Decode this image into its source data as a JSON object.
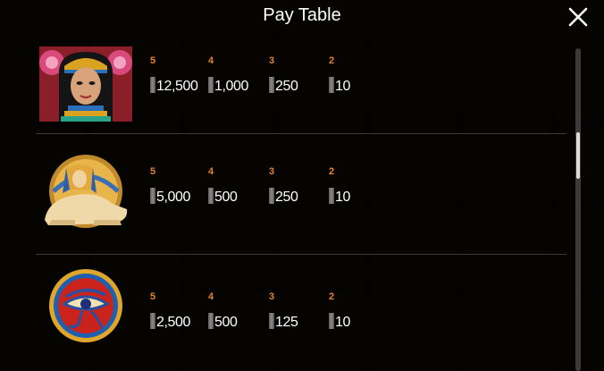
{
  "header": {
    "title": "Pay Table",
    "close_icon": "close-icon"
  },
  "paytable": [
    {
      "symbol": "cleopatra-icon",
      "payouts": [
        {
          "count": "5",
          "value": "12,500"
        },
        {
          "count": "4",
          "value": "1,000"
        },
        {
          "count": "3",
          "value": "250"
        },
        {
          "count": "2",
          "value": "10"
        }
      ]
    },
    {
      "symbol": "sphinx-icon",
      "payouts": [
        {
          "count": "5",
          "value": "5,000"
        },
        {
          "count": "4",
          "value": "500"
        },
        {
          "count": "3",
          "value": "250"
        },
        {
          "count": "2",
          "value": "10"
        }
      ]
    },
    {
      "symbol": "eye-of-horus-icon",
      "payouts": [
        {
          "count": "5",
          "value": "2,500"
        },
        {
          "count": "4",
          "value": "500"
        },
        {
          "count": "3",
          "value": "125"
        },
        {
          "count": "2",
          "value": "10"
        }
      ]
    }
  ],
  "colors": {
    "count_color": "#e8832a",
    "value_color": "#ffffff",
    "overlay": "#000000"
  }
}
